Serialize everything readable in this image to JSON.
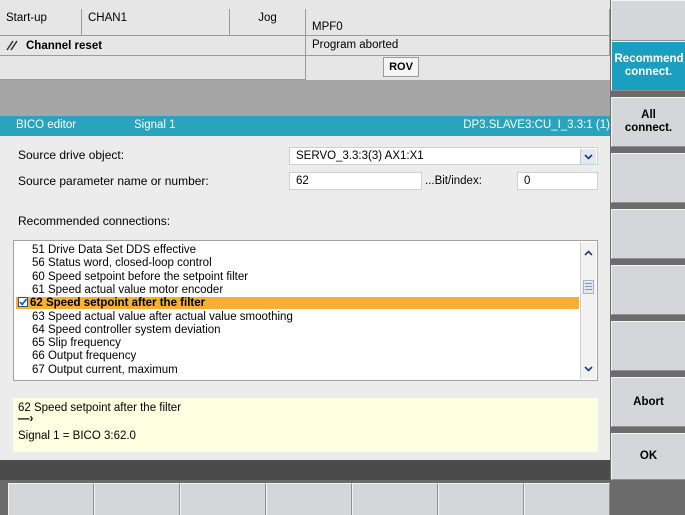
{
  "header": {
    "mode": "Start-up",
    "channel": "CHAN1",
    "op_mode": "Jog",
    "program": "MPF0",
    "channel_status": "Channel reset",
    "program_status": "Program aborted",
    "rov": "ROV"
  },
  "titlebar": {
    "left": "BICO editor",
    "middle": "Signal 1",
    "right": "DP3.SLAVE3:CU_I_3.3:1 (1)"
  },
  "form": {
    "source_drive_label": "Source drive object:",
    "source_drive_value": "SERVO_3.3:3(3)  AX1:X1",
    "source_param_label": "Source parameter name or number:",
    "source_param_value": "62",
    "bit_index_label": "...Bit/index:",
    "bit_index_value": "0",
    "recommended_label": "Recommended connections:"
  },
  "list_items": [
    {
      "text": "51 Drive Data Set DDS effective",
      "selected": false
    },
    {
      "text": "56 Status word, closed-loop control",
      "selected": false
    },
    {
      "text": "60 Speed setpoint before the setpoint filter",
      "selected": false
    },
    {
      "text": "61 Speed actual value motor encoder",
      "selected": false
    },
    {
      "text": "62 Speed setpoint after the filter",
      "selected": true
    },
    {
      "text": "63 Speed actual value after actual value smoothing",
      "selected": false
    },
    {
      "text": "64 Speed controller system deviation",
      "selected": false
    },
    {
      "text": "65 Slip frequency",
      "selected": false
    },
    {
      "text": "66 Output frequency",
      "selected": false
    },
    {
      "text": "67 Output current, maximum",
      "selected": false
    }
  ],
  "info": {
    "line1": "62 Speed setpoint after the filter",
    "arrow": "—›",
    "line3": "Signal 1 = BICO 3:62.0"
  },
  "softkeys": {
    "recommended": "Recommend connect.",
    "all": "All connect.",
    "abort": "Abort",
    "ok": "OK"
  },
  "colors": {
    "titlebar": "#2aa3bd",
    "selected_row": "#f6b02f",
    "active_softkey": "#1b9fc1",
    "info_bg": "#fefee0"
  }
}
